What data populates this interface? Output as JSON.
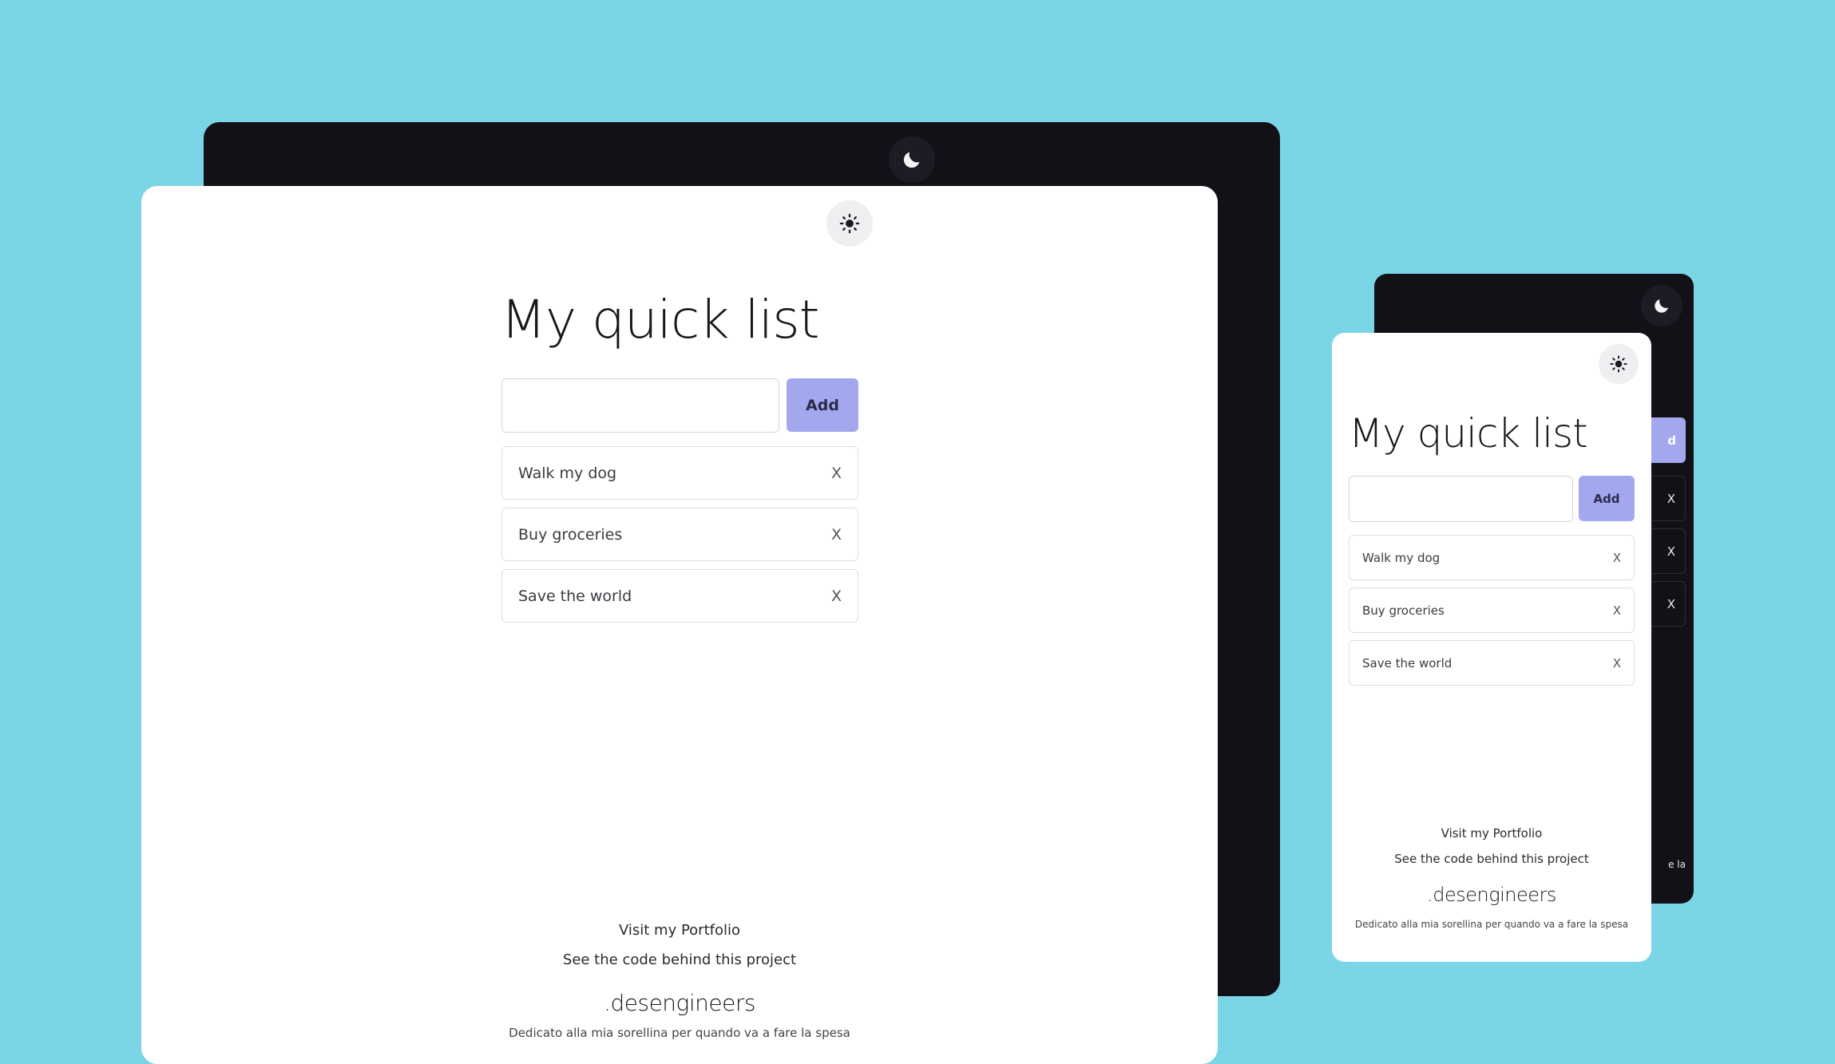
{
  "app": {
    "title": "My quick list",
    "add_label": "Add",
    "input_value": "",
    "input_placeholder": "",
    "remove_label": "X",
    "items": [
      {
        "label": "Walk my dog"
      },
      {
        "label": "Buy groceries"
      },
      {
        "label": "Save the world"
      }
    ],
    "footer": {
      "portfolio_link": "Visit my Portfolio",
      "code_link": "See the code behind this project",
      "brand": ".desengineers",
      "dedication": "Dedicato alla mia sorellina per quando va a fare la spesa",
      "dark_dedication_fragment": "e la"
    },
    "dark_add_fragment": "d"
  },
  "icons": {
    "dark_mode": "moon-icon",
    "light_mode": "sun-icon"
  },
  "colors": {
    "background": "#7ad5e7",
    "dark_panel": "#111117",
    "light_panel": "#ffffff",
    "accent": "#a3a7ee"
  }
}
